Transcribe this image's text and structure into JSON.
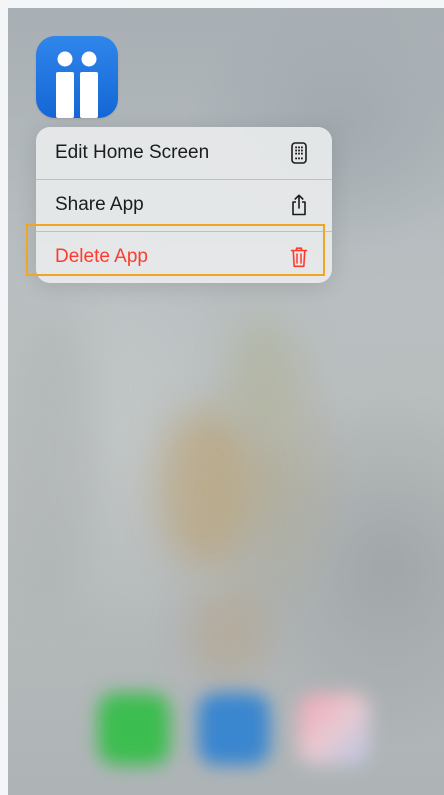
{
  "app": {
    "icon_name": "app-icon",
    "icon_color": "#1f74de"
  },
  "context_menu": {
    "items": [
      {
        "label": "Edit Home Screen",
        "icon": "phone-grid-icon",
        "color": "#1c1c1e"
      },
      {
        "label": "Share App",
        "icon": "share-icon",
        "color": "#1c1c1e"
      },
      {
        "label": "Delete App",
        "icon": "trash-icon",
        "color": "#ff3b30"
      }
    ]
  },
  "highlight": {
    "target": "Delete App",
    "color": "#f0a523"
  },
  "dock": {
    "apps": [
      "phone-app-icon",
      "safari-app-icon",
      "photos-app-icon"
    ]
  }
}
